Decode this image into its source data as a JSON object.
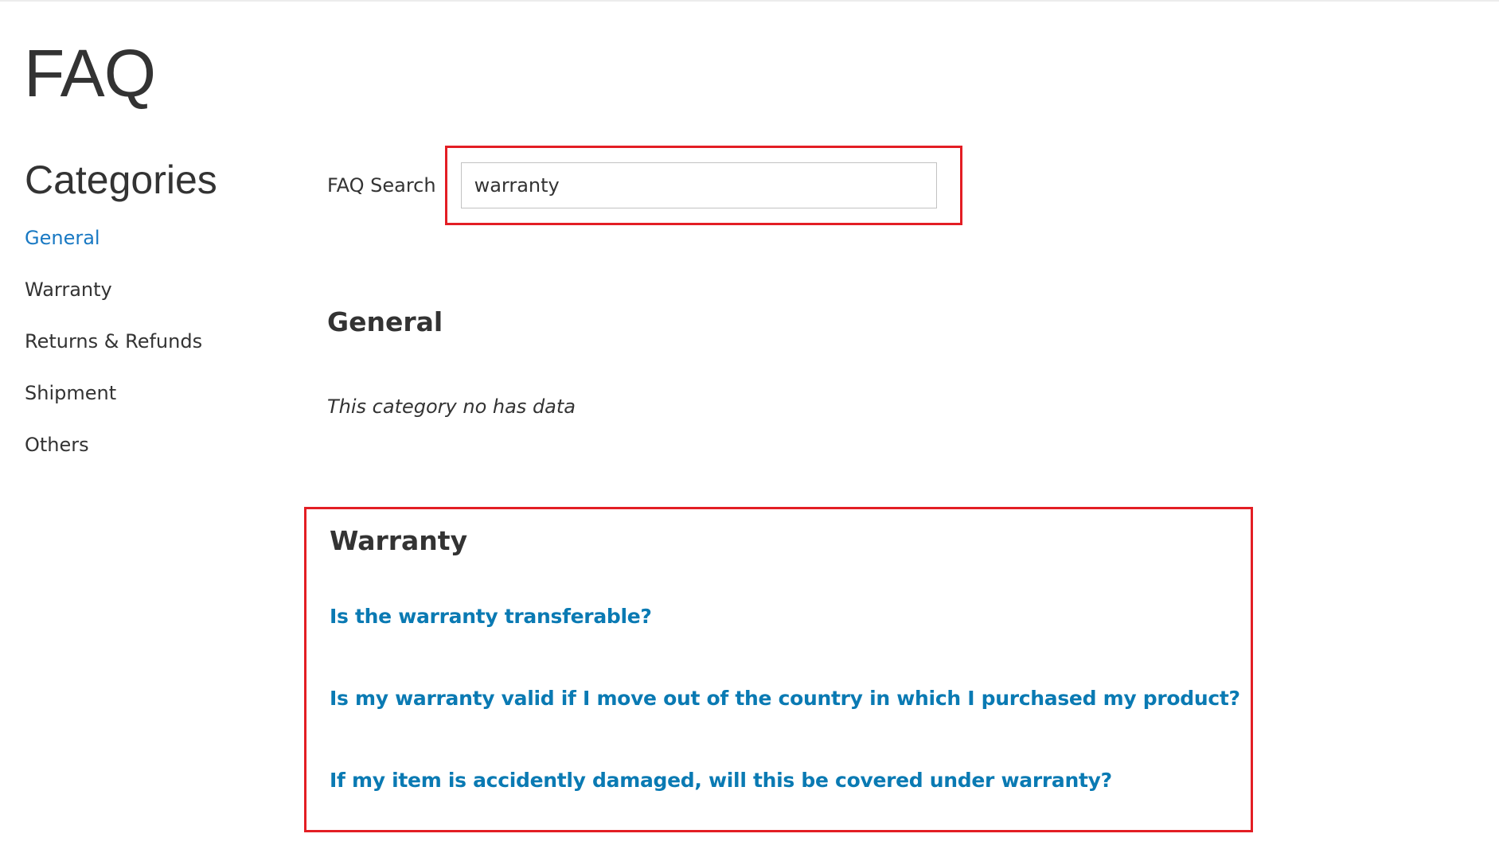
{
  "page": {
    "title": "FAQ"
  },
  "sidebar": {
    "title": "Categories",
    "items": [
      {
        "label": "General",
        "active": true
      },
      {
        "label": "Warranty",
        "active": false
      },
      {
        "label": "Returns & Refunds",
        "active": false
      },
      {
        "label": "Shipment",
        "active": false
      },
      {
        "label": "Others",
        "active": false
      }
    ]
  },
  "search": {
    "label": "FAQ Search",
    "value": "warranty"
  },
  "sections": {
    "general": {
      "title": "General",
      "empty_message": "This category no has data"
    },
    "warranty": {
      "title": "Warranty",
      "questions": [
        "Is the warranty transferable?",
        "Is my warranty valid if I move out of the country in which I purchased my product?",
        "If my item is accidently damaged, will this be covered under warranty?"
      ]
    }
  },
  "colors": {
    "accent": "#1979c3",
    "link": "#0a7ab3",
    "highlight": "#e31e24",
    "text": "#333333"
  }
}
